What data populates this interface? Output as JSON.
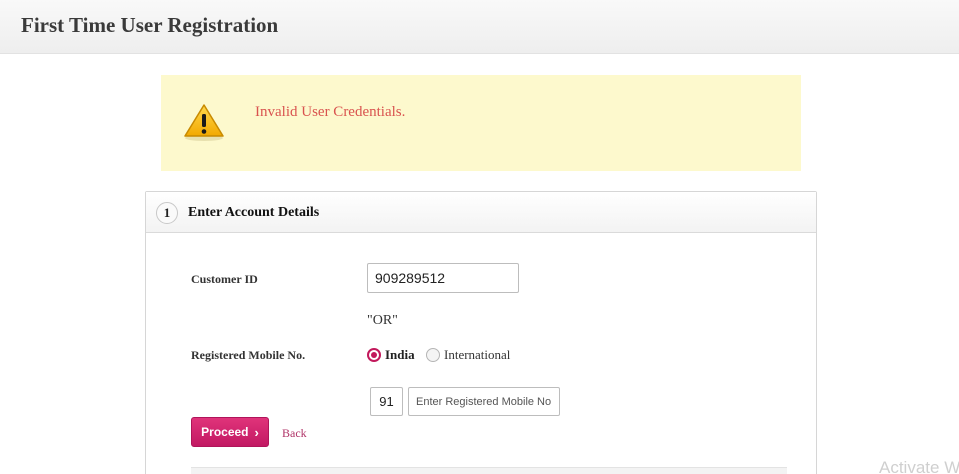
{
  "header": {
    "title": "First Time User Registration"
  },
  "alert": {
    "icon": "warning-icon",
    "message": "Invalid User Credentials.",
    "color": "#d9534f",
    "background": "#fdf9cd"
  },
  "panel": {
    "step_number": "1",
    "title": "Enter Account Details",
    "customer_id_label": "Customer ID",
    "customer_id_value": "909289512",
    "or_text": "\"OR\"",
    "mobile_label": "Registered Mobile No.",
    "radio_india": "India",
    "radio_international": "International",
    "selected_radio": "India",
    "country_code": "91",
    "mobile_placeholder": "Enter Registered Mobile No.",
    "proceed_label": "Proceed",
    "back_label": "Back",
    "accent_color": "#c2185b"
  },
  "watermark": {
    "text": "Activate W"
  }
}
